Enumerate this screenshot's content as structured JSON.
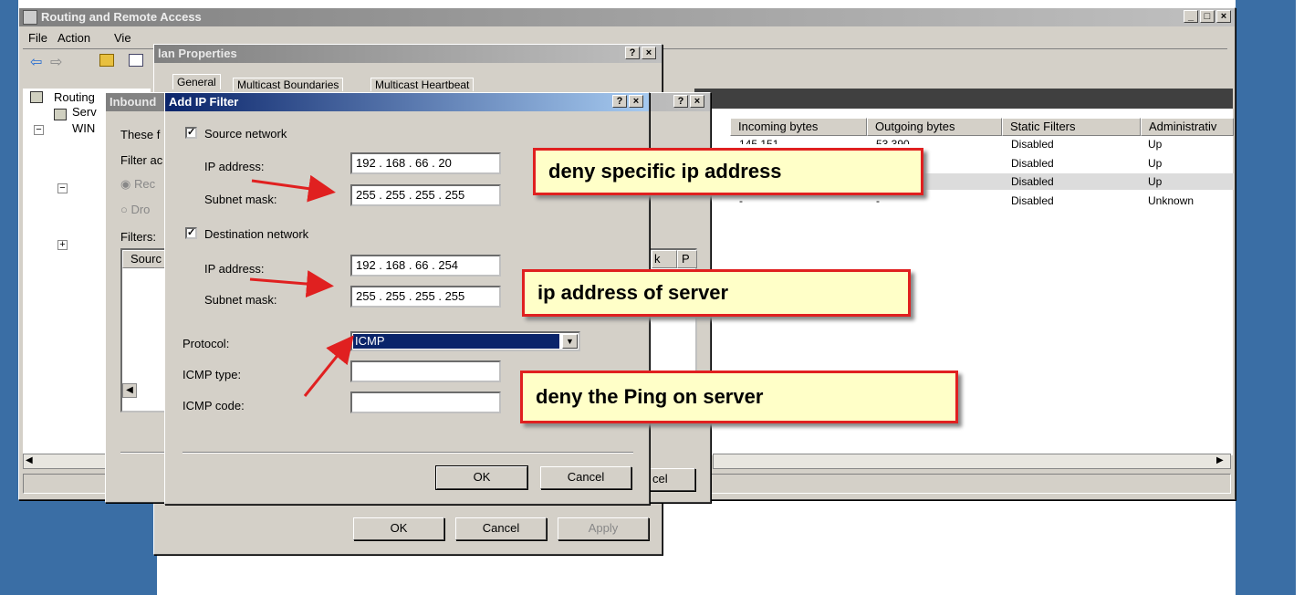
{
  "main_window": {
    "title": "Routing and Remote Access",
    "menu": [
      "File",
      "Action",
      "Vie"
    ],
    "columns": [
      "Incoming bytes",
      "Outgoing bytes",
      "Static Filters",
      "Administrativ"
    ],
    "rows": [
      [
        "145,151",
        "53,390",
        "Disabled",
        "Up"
      ],
      [
        "",
        "",
        "Disabled",
        "Up"
      ],
      [
        "",
        "",
        "Disabled",
        "Up"
      ],
      [
        "-",
        "-",
        "Disabled",
        "Unknown"
      ]
    ],
    "tree": [
      "Routing",
      "Serv",
      "WIN"
    ]
  },
  "lan_properties": {
    "title": "lan Properties",
    "tabs": [
      "General",
      "Multicast Boundaries",
      "Multicast Heartbeat"
    ],
    "ok": "OK",
    "cancel": "Cancel",
    "apply": "Apply"
  },
  "inbound": {
    "title": "Inbound",
    "these": "These f",
    "filter_action": "Filter ac",
    "radio1": "Rec",
    "radio2": "Dro",
    "filters": "Filters:",
    "col_source": "Sourc",
    "col_k": "k",
    "col_p": "P",
    "cancel_partial": "cel"
  },
  "add_ip_filter": {
    "title": "Add IP Filter",
    "source_network": "Source network",
    "ip_address_label": "IP address:",
    "subnet_mask_label": "Subnet mask:",
    "src_ip": "192 . 168 .  66  .  20",
    "src_mask": "255 . 255 . 255 . 255",
    "destination_network": "Destination network",
    "dst_ip": "192 . 168 .  66  . 254",
    "dst_mask": "255 . 255 . 255 . 255",
    "protocol_label": "Protocol:",
    "protocol_value": "ICMP",
    "icmp_type_label": "ICMP type:",
    "icmp_code_label": "ICMP code:",
    "icmp_type": "",
    "icmp_code": "",
    "ok": "OK",
    "cancel": "Cancel"
  },
  "callouts": {
    "one": "deny specific ip address",
    "two": "ip address of server",
    "three": "deny the Ping on server"
  },
  "caption_buttons": {
    "help": "?",
    "close": "×",
    "min": "_",
    "max": "□"
  },
  "colors": {
    "desktop": "#3a6ea5",
    "callout_bg": "#ffffc8",
    "callout_border": "#e02020",
    "arrow": "#e02020"
  }
}
